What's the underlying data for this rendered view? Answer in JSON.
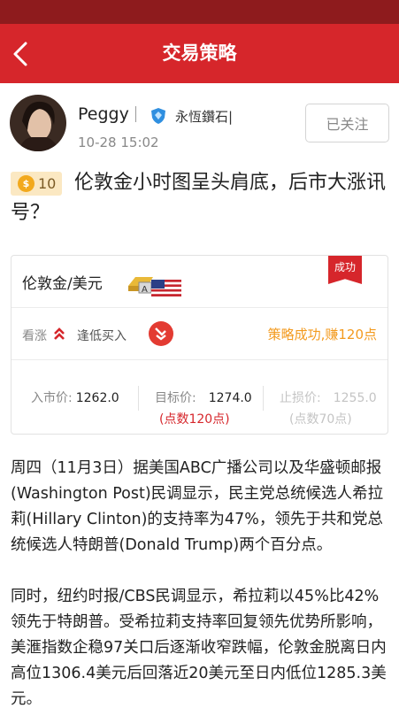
{
  "nav": {
    "title": "交易策略"
  },
  "author": {
    "name": "Peggy",
    "badge": "永恆鑽石|",
    "time": "10-28 15:02",
    "follow_label": "已关注"
  },
  "post": {
    "coins": "10",
    "title": "伦敦金小时图呈头肩底，后市大涨讯号？"
  },
  "strategy": {
    "pair": "伦敦金/美元",
    "status": "成功",
    "direction": "看涨",
    "action": "逢低买入",
    "result": "策略成功,赚120点",
    "entry_label": "入市价:",
    "entry_value": "1262.0",
    "target_label": "目标价:",
    "target_value": "1274.0",
    "target_points": "(点数120点)",
    "stop_label": "止损价:",
    "stop_value": "1255.0",
    "stop_points": "(点数70点)"
  },
  "article": {
    "para1": "周四（11月3日）据美国ABC广播公司以及华盛顿邮报(Washington Post)民调显示，民主党总统候选人希拉莉(Hillary Clinton)的支持率为47%，领先于共和党总统候选人特朗普(Donald Trump)两个百分点。",
    "para2": "同时，纽约时报/CBS民调显示，希拉莉以45%比42%领先于特朗普。受希拉莉支持率回复领先优势所影响，美滙指数企稳97关口后逐渐收窄跌幅，伦敦金脱离日内高位1306.4美元后回落近20美元至日内低位1285.3美元。"
  },
  "colors": {
    "accent": "#d6262b",
    "status_bar": "#8e1b1d",
    "result_orange": "#f39a1e"
  },
  "icons": {
    "back": "chevron-left-icon",
    "badge": "diamond-shield-icon",
    "coin": "coin-icon",
    "gold": "gold-bar-flag-icon",
    "up": "double-up-arrow-icon",
    "action": "buy-low-icon"
  }
}
